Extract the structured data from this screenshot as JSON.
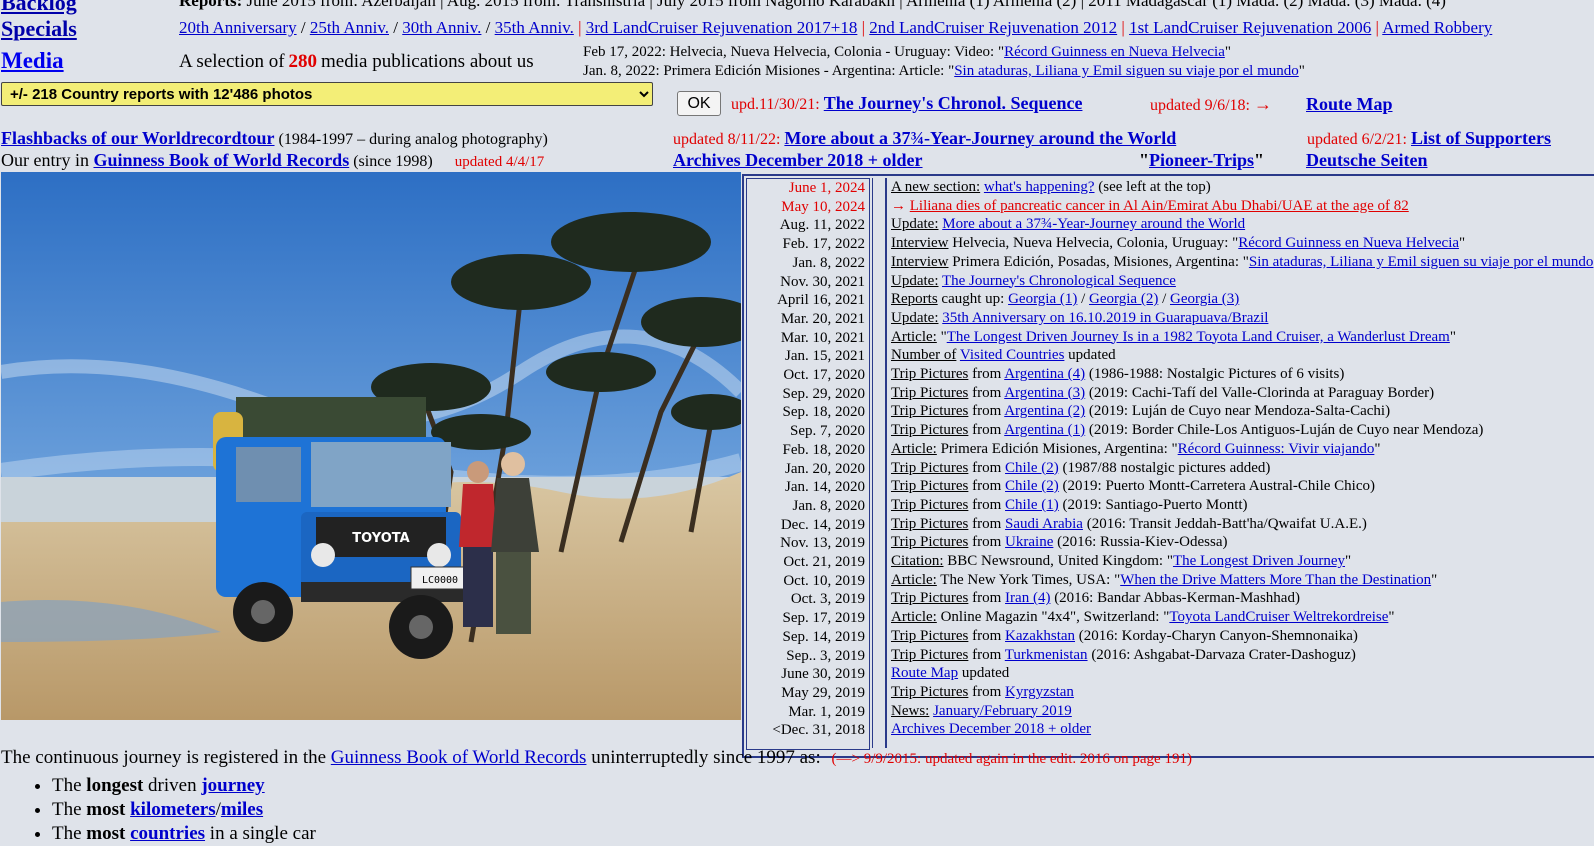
{
  "leftnav": {
    "backlog": "Backlog",
    "specials": "Specials",
    "media": "Media"
  },
  "reports_line": {
    "label": "Reports:",
    "text": "June 2015 from: Azerbaijan | Aug. 2015 from: Transnistria | July 2015 from Nagorno Karabakh | Armenia (1) Armenia (2) | 2011 Madagascar (1) Mada. (2) Mada. (3) Mada. (4)"
  },
  "specials_line": {
    "items": [
      "20th Anniversary",
      "25th Anniv.",
      "30th Anniv.",
      "35th Anniv.",
      "3rd LandCruiser Rejuvenation 2017+18",
      "2nd LandCruiser Rejuvenation 2012",
      "1st LandCruiser Rejuvenation 2006",
      "Armed Robbery"
    ]
  },
  "media": {
    "prefix": "A selection of",
    "count": "280",
    "suffix": "media publications about us",
    "pub1_text": "Feb 17, 2022: Helvecia, Nueva Helvecia, Colonia - Uruguay: Video: \"",
    "pub1_link": "Récord Guinness en Nueva Helvecia",
    "pub1_end": "\"",
    "pub2_text": "Jan. 8, 2022: Primera Edición Misiones - Argentina: Article: \"",
    "pub2_link": "Sin ataduras, Liliana y Emil siguen su viaje por el mundo",
    "pub2_end": "\""
  },
  "country_select": {
    "value": "+/- 218 Country reports with 12'486 photos"
  },
  "ok_button": "OK",
  "chrono": {
    "upd": "upd.11/30/21:",
    "link": "The Journey's Chronol.  Sequence",
    "upd2": "updated 9/6/18:",
    "arrow": "→",
    "route": "Route Map"
  },
  "flashbacks": {
    "link": "Flashbacks of our Worldrecordtour",
    "note": " (1984-1997 – during analog photography)"
  },
  "guinness_entry": {
    "prefix": "Our entry in ",
    "link": "Guinness Book of World Records",
    "since": " (since 1998)",
    "upd": "updated 4/4/17"
  },
  "more_about": {
    "upd": "updated 8/11/22:",
    "link": "More about a 37¾-Year-Journey around the World"
  },
  "supporters": {
    "upd": "updated 6/2/21:",
    "link": "List of Supporters"
  },
  "archives": {
    "link": "Archives December 2018 + older"
  },
  "pioneer": {
    "q1": "\"",
    "link": "Pioneer-Trips",
    "q2": "\""
  },
  "deutsch": {
    "link": "Deutsche Seiten"
  },
  "photo": {
    "plate": "LC0000",
    "brand": "TOYOTA"
  },
  "updates": [
    {
      "date": "June 1, 2024",
      "red": true,
      "parts": [
        [
          "u",
          "A new section:"
        ],
        [
          "t",
          " "
        ],
        [
          "l",
          "what's happening?"
        ],
        [
          "t",
          " (see left at the top)"
        ]
      ]
    },
    {
      "date": "May 10, 2024",
      "red": true,
      "parts": [
        [
          "r",
          "→ "
        ],
        [
          "lr",
          "Liliana dies of pancreatic cancer in Al Ain/Emirat Abu Dhabi/UAE at the age of 82"
        ]
      ]
    },
    {
      "date": "Aug. 11, 2022",
      "parts": [
        [
          "u",
          "Update:"
        ],
        [
          "t",
          " "
        ],
        [
          "l",
          "More about a 37¾-Year-Journey around the World"
        ]
      ]
    },
    {
      "date": "Feb. 17, 2022",
      "parts": [
        [
          "u",
          "Interview"
        ],
        [
          "t",
          " Helvecia, Nueva Helvecia, Colonia, Uruguay: \""
        ],
        [
          "l",
          "Récord Guinness en Nueva Helvecia"
        ],
        [
          "t",
          "\""
        ]
      ]
    },
    {
      "date": "Jan. 8, 2022",
      "parts": [
        [
          "u",
          "Interview"
        ],
        [
          "t",
          " Primera Edición, Posadas, Misiones, Argentina: \""
        ],
        [
          "l",
          "Sin ataduras, Liliana y Emil siguen su viaje por el mundo"
        ],
        [
          "t",
          "\""
        ]
      ]
    },
    {
      "date": "Nov. 30, 2021",
      "parts": [
        [
          "u",
          "Update:"
        ],
        [
          "t",
          " "
        ],
        [
          "l",
          "The Journey's Chronological Sequence"
        ]
      ]
    },
    {
      "date": "April 16, 2021",
      "parts": [
        [
          "u",
          "Reports"
        ],
        [
          "t",
          " caught up: "
        ],
        [
          "l",
          "Georgia (1)"
        ],
        [
          "t",
          " / "
        ],
        [
          "l",
          "Georgia (2)"
        ],
        [
          "t",
          " / "
        ],
        [
          "l",
          "Georgia (3)"
        ]
      ]
    },
    {
      "date": "Mar. 20, 2021",
      "parts": [
        [
          "u",
          "Update:"
        ],
        [
          "t",
          " "
        ],
        [
          "l",
          "35th Anniversary on 16.10.2019 in Guarapuava/Brazil"
        ]
      ]
    },
    {
      "date": "Mar. 10, 2021",
      "parts": [
        [
          "u",
          "Article:"
        ],
        [
          "t",
          " \""
        ],
        [
          "l",
          "The Longest Driven Journey Is in a 1982 Toyota Land Cruiser, a Wanderlust Dream"
        ],
        [
          "t",
          "\""
        ]
      ]
    },
    {
      "date": "Jan. 15, 2021",
      "parts": [
        [
          "u",
          "Number of"
        ],
        [
          "t",
          " "
        ],
        [
          "l",
          "Visited Countries"
        ],
        [
          "t",
          " updated"
        ]
      ]
    },
    {
      "date": "Oct. 17, 2020",
      "parts": [
        [
          "u",
          "Trip Pictures"
        ],
        [
          "t",
          " from "
        ],
        [
          "l",
          "Argentina (4)"
        ],
        [
          "t",
          "  (1986-1988: Nostalgic Pictures of 6 visits)"
        ]
      ]
    },
    {
      "date": "Sep. 29, 2020",
      "parts": [
        [
          "u",
          "Trip Pictures"
        ],
        [
          "t",
          " from "
        ],
        [
          "l",
          "Argentina (3)"
        ],
        [
          "t",
          "  (2019: Cachi-Tafí del Valle-Clorinda at Paraguay Border)"
        ]
      ]
    },
    {
      "date": "Sep. 18, 2020",
      "parts": [
        [
          "u",
          "Trip Pictures"
        ],
        [
          "t",
          " from "
        ],
        [
          "l",
          "Argentina (2)"
        ],
        [
          "t",
          "  (2019: Luján de Cuyo near Mendoza-Salta-Cachi)"
        ]
      ]
    },
    {
      "date": "Sep. 7, 2020",
      "parts": [
        [
          "u",
          "Trip Pictures"
        ],
        [
          "t",
          " from "
        ],
        [
          "l",
          "Argentina (1)"
        ],
        [
          "t",
          "  (2019: Border Chile-Los Antiguos-Luján de Cuyo near Mendoza)"
        ]
      ]
    },
    {
      "date": "Feb. 18, 2020",
      "parts": [
        [
          "u",
          "Article:"
        ],
        [
          "t",
          " Primera Edición Misiones, Argentina: \""
        ],
        [
          "l",
          "Récord Guinness: Vivir viajando"
        ],
        [
          "t",
          "\""
        ]
      ]
    },
    {
      "date": "Jan. 20, 2020",
      "parts": [
        [
          "u",
          "Trip Pictures"
        ],
        [
          "t",
          " from "
        ],
        [
          "l",
          "Chile (2)"
        ],
        [
          "t",
          "  (1987/88 nostalgic pictures added)"
        ]
      ]
    },
    {
      "date": "Jan. 14, 2020",
      "parts": [
        [
          "u",
          "Trip Pictures"
        ],
        [
          "t",
          " from "
        ],
        [
          "l",
          "Chile (2)"
        ],
        [
          "t",
          "  (2019: Puerto Montt-Carretera Austral-Chile Chico)"
        ]
      ]
    },
    {
      "date": "Jan. 8, 2020",
      "parts": [
        [
          "u",
          "Trip Pictures"
        ],
        [
          "t",
          " from "
        ],
        [
          "l",
          "Chile (1)"
        ],
        [
          "t",
          "  (2019: Santiago-Puerto Montt)"
        ]
      ]
    },
    {
      "date": "Dec. 14, 2019",
      "parts": [
        [
          "u",
          "Trip Pictures"
        ],
        [
          "t",
          " from "
        ],
        [
          "l",
          "Saudi Arabia"
        ],
        [
          "t",
          "  (2016: Transit Jeddah-Batt'ha/Qwaifat U.A.E.)"
        ]
      ]
    },
    {
      "date": "Nov. 13, 2019",
      "parts": [
        [
          "u",
          "Trip Pictures"
        ],
        [
          "t",
          " from "
        ],
        [
          "l",
          "Ukraine"
        ],
        [
          "t",
          "  (2016: Russia-Kiev-Odessa)"
        ]
      ]
    },
    {
      "date": "Oct. 21, 2019",
      "parts": [
        [
          "u",
          "Citation:"
        ],
        [
          "t",
          " BBC Newsround, United Kingdom: \""
        ],
        [
          "l",
          "The Longest Driven Journey"
        ],
        [
          "t",
          "\""
        ]
      ]
    },
    {
      "date": "Oct. 10, 2019",
      "parts": [
        [
          "u",
          "Article:"
        ],
        [
          "t",
          " The New York Times, USA: \""
        ],
        [
          "l",
          "When the Drive Matters More Than the Destination"
        ],
        [
          "t",
          "\""
        ]
      ]
    },
    {
      "date": "Oct. 3, 2019",
      "parts": [
        [
          "u",
          "Trip Pictures"
        ],
        [
          "t",
          " from "
        ],
        [
          "l",
          "Iran (4)"
        ],
        [
          "t",
          "  (2016: Bandar Abbas-Kerman-Mashhad)"
        ]
      ]
    },
    {
      "date": "Sep. 17, 2019",
      "parts": [
        [
          "u",
          "Article:"
        ],
        [
          "t",
          " Online Magazin \"4x4\", Switzerland: \""
        ],
        [
          "l",
          "Toyota LandCruiser Weltrekordreise"
        ],
        [
          "t",
          "\""
        ]
      ]
    },
    {
      "date": "Sep. 14, 2019",
      "parts": [
        [
          "u",
          "Trip Pictures"
        ],
        [
          "t",
          " from "
        ],
        [
          "l",
          "Kazakhstan"
        ],
        [
          "t",
          "  (2016: Korday-Charyn Canyon-Shemnonaika)"
        ]
      ]
    },
    {
      "date": "Sep.. 3, 2019",
      "parts": [
        [
          "u",
          "Trip Pictures"
        ],
        [
          "t",
          " from "
        ],
        [
          "l",
          "Turkmenistan"
        ],
        [
          "t",
          "  (2016: Ashgabat-Darvaza Crater-Dashoguz)"
        ]
      ]
    },
    {
      "date": "June 30, 2019",
      "parts": [
        [
          "l",
          "Route Map"
        ],
        [
          "t",
          " updated"
        ]
      ]
    },
    {
      "date": "May 29, 2019",
      "parts": [
        [
          "u",
          "Trip Pictures"
        ],
        [
          "t",
          " from "
        ],
        [
          "l",
          "Kyrgyzstan"
        ]
      ]
    },
    {
      "date": "Mar. 1, 2019",
      "parts": [
        [
          "u",
          "News:"
        ],
        [
          "t",
          " "
        ],
        [
          "l",
          "January/February 2019"
        ]
      ]
    },
    {
      "date": "<Dec. 31, 2018",
      "parts": [
        [
          "l",
          "Archives December 2018 + older"
        ]
      ]
    }
  ],
  "continuous": {
    "prefix": "The continuous journey is registered in the ",
    "link": "Guinness Book of World Records",
    "suffix": " uninterruptedly since 1997 as:",
    "note": "(—>  9/9/2015: updated again in the edit. 2016 on page 191)"
  },
  "records": [
    {
      "pre": "The ",
      "b": "longest",
      "mid": " driven ",
      "links": [
        "journey"
      ],
      "post": ""
    },
    {
      "pre": "The ",
      "b": "most",
      "mid": " ",
      "links": [
        "kilometers",
        "miles"
      ],
      "post": ""
    },
    {
      "pre": "The ",
      "b": "most",
      "mid": " ",
      "links": [
        "countries"
      ],
      "post": " in a single car"
    }
  ]
}
